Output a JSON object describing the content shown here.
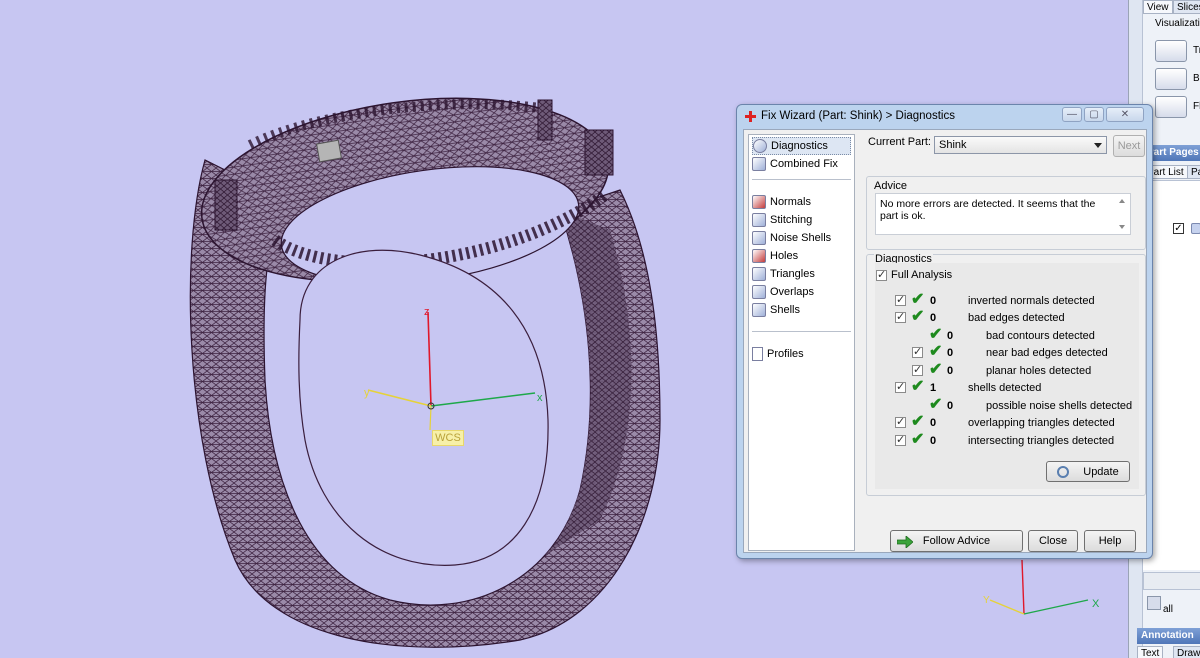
{
  "viewport": {
    "wcs_label": "WCS",
    "axis_z": "z",
    "axis_x": "x",
    "axis_y": "y",
    "mini_axis_x": "X",
    "mini_axis_y": "Y",
    "background_color": "#c7c6f2",
    "mesh_color": "#4a2847"
  },
  "side_panel": {
    "tabs": [
      "View",
      "Slices"
    ],
    "visualization_label": "Visualizatio",
    "buttons": [
      "Tr",
      "Ba",
      "Fl"
    ],
    "part_pages_header": "Part Pages",
    "part_tabs": [
      "Part List",
      "Pa"
    ],
    "annotation_header": "Annotation",
    "annotation_tabs": [
      "Text",
      "Drawi"
    ],
    "all_label": "all"
  },
  "dialog": {
    "title": "Fix Wizard (Part: Shink) > Diagnostics",
    "nav_top": [
      {
        "label": "Diagnostics",
        "icon": "magnifier-icon",
        "selected": true
      },
      {
        "label": "Combined Fix",
        "icon": "cube-icon"
      }
    ],
    "nav_tools": [
      {
        "label": "Normals",
        "icon": "normals-icon"
      },
      {
        "label": "Stitching",
        "icon": "stitching-icon"
      },
      {
        "label": "Noise Shells",
        "icon": "noise-shells-icon"
      },
      {
        "label": "Holes",
        "icon": "holes-icon"
      },
      {
        "label": "Triangles",
        "icon": "triangles-icon"
      },
      {
        "label": "Overlaps",
        "icon": "overlaps-icon"
      },
      {
        "label": "Shells",
        "icon": "shells-icon"
      }
    ],
    "nav_bottom": [
      {
        "label": "Profiles",
        "icon": "document-icon"
      }
    ],
    "current_part_label": "Current Part:",
    "current_part_value": "Shink",
    "next_button": "Next",
    "advice_title": "Advice",
    "advice_text": "No more errors are detected. It seems that the part is ok.",
    "diagnostics_title": "Diagnostics",
    "full_analysis_label": "Full Analysis",
    "rows": [
      {
        "count": "0",
        "label": "inverted normals detected",
        "checkbox": true,
        "indent": false
      },
      {
        "count": "0",
        "label": "bad edges detected",
        "checkbox": true,
        "indent": false
      },
      {
        "count": "0",
        "label": "bad contours detected",
        "checkbox": false,
        "indent": true
      },
      {
        "count": "0",
        "label": "near bad edges detected",
        "checkbox": true,
        "indent": true
      },
      {
        "count": "0",
        "label": "planar holes detected",
        "checkbox": true,
        "indent": true
      },
      {
        "count": "1",
        "label": "shells detected",
        "checkbox": true,
        "indent": false
      },
      {
        "count": "0",
        "label": "possible noise shells detected",
        "checkbox": false,
        "indent": true
      },
      {
        "count": "0",
        "label": "overlapping triangles detected",
        "checkbox": true,
        "indent": false
      },
      {
        "count": "0",
        "label": "intersecting triangles detected",
        "checkbox": true,
        "indent": false
      }
    ],
    "update_button": "Update",
    "follow_advice_button": "Follow Advice",
    "close_button": "Close",
    "help_button": "Help"
  }
}
